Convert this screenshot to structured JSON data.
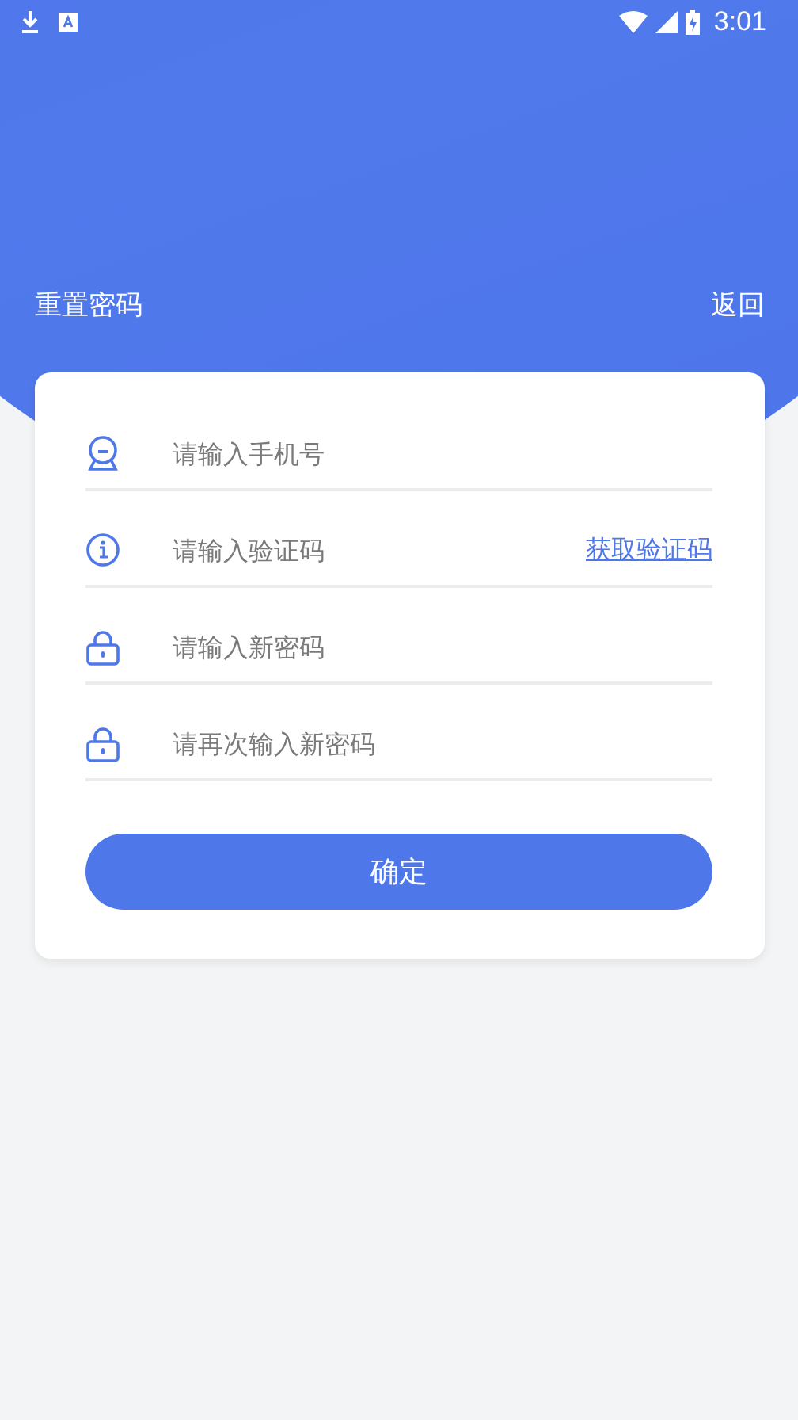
{
  "status_bar": {
    "time": "3:01"
  },
  "header": {
    "title": "重置密码",
    "back": "返回"
  },
  "form": {
    "fields": [
      {
        "kind": "person",
        "placeholder": "请输入手机号"
      },
      {
        "kind": "info",
        "placeholder": "请输入验证码",
        "action": "获取验证码"
      },
      {
        "kind": "lock",
        "placeholder": "请输入新密码"
      },
      {
        "kind": "lock",
        "placeholder": "请再次输入新密码"
      }
    ],
    "submit": "确定"
  }
}
